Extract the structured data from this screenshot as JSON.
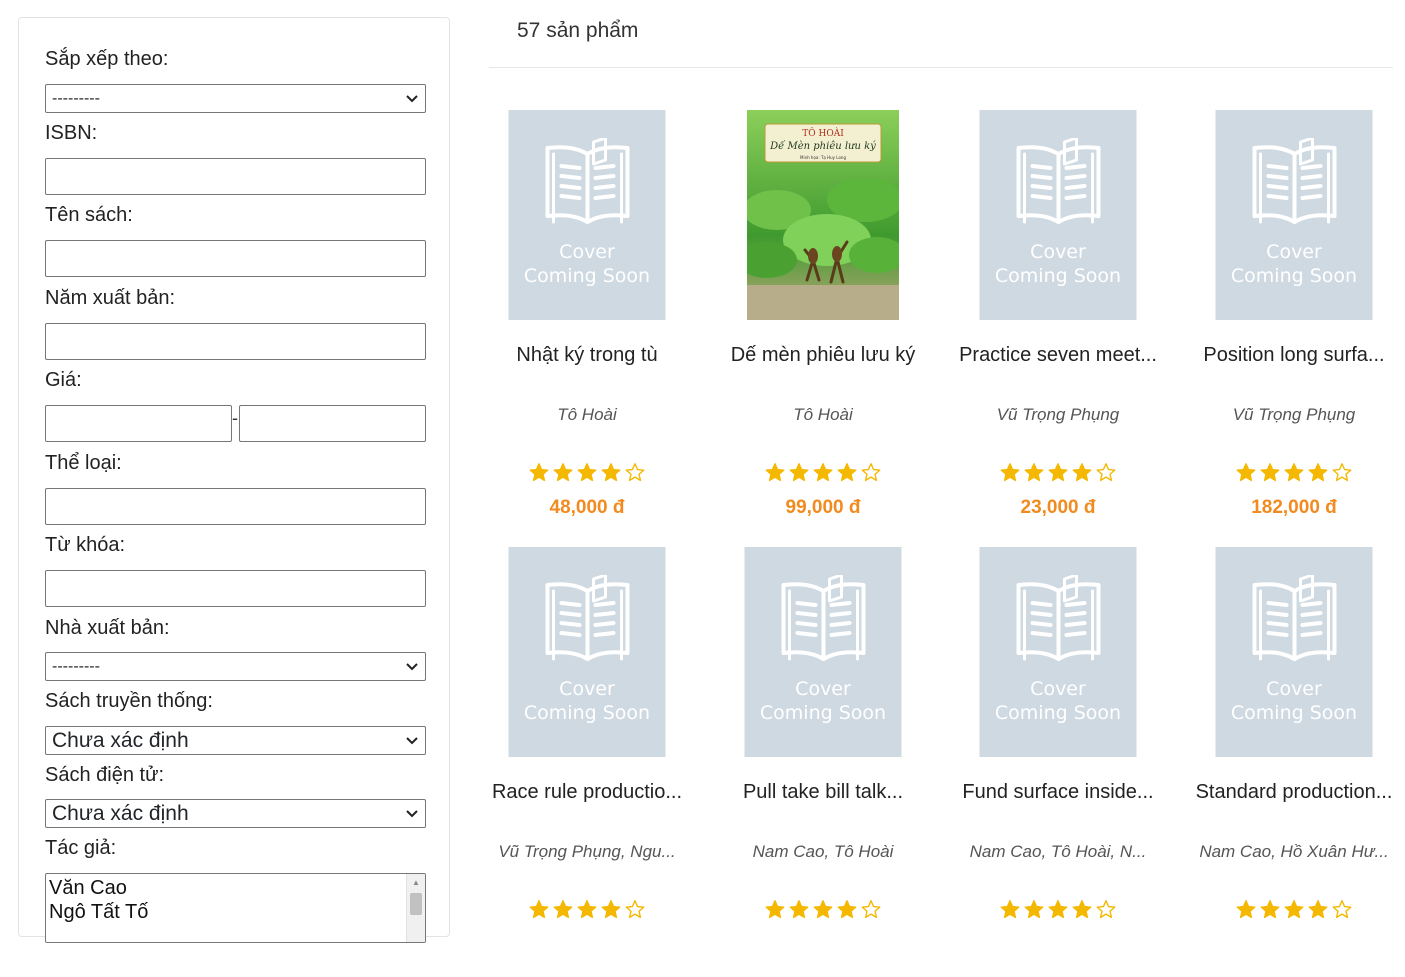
{
  "filters": {
    "sort_label": "Sắp xếp theo:",
    "sort_value": "---------",
    "isbn_label": "ISBN:",
    "title_label": "Tên sách:",
    "year_label": "Năm xuất bản:",
    "price_label": "Giá:",
    "price_separator": "-",
    "genre_label": "Thể loại:",
    "keyword_label": "Từ khóa:",
    "publisher_label": "Nhà xuất bản:",
    "publisher_value": "---------",
    "traditional_label": "Sách truyền thống:",
    "traditional_value": "Chưa xác định",
    "ebook_label": "Sách điện tử:",
    "ebook_value": "Chưa xác định",
    "author_label": "Tác giả:",
    "author_options": [
      "Văn Cao",
      "Ngô Tất Tố"
    ]
  },
  "results": {
    "count_text": "57 sản phẩm"
  },
  "cover_placeholder": {
    "line1": "Cover",
    "line2": "Coming Soon",
    "background": "#cfd9e2"
  },
  "featured_cover": {
    "author": "TÔ HOÀI",
    "title": "Dế Mèn phiêu lưu ký",
    "illustrator": "Minh họa: Tạ Huy Long"
  },
  "colors": {
    "price": "#f28b1f",
    "star": "#f5b800"
  },
  "products": [
    {
      "title": "Nhật ký trong tù",
      "author": "Tô Hoài",
      "rating": 4,
      "price": "48,000 đ",
      "has_cover": false
    },
    {
      "title": "Dế mèn phiêu lưu ký",
      "author": "Tô Hoài",
      "rating": 4,
      "price": "99,000 đ",
      "has_cover": true
    },
    {
      "title": "Practice seven meet...",
      "author": "Vũ Trọng Phụng",
      "rating": 4,
      "price": "23,000 đ",
      "has_cover": false
    },
    {
      "title": "Position long surfa...",
      "author": "Vũ Trọng Phụng",
      "rating": 4,
      "price": "182,000 đ",
      "has_cover": false
    },
    {
      "title": "Race rule productio...",
      "author": "Vũ Trọng Phụng, Ngu...",
      "rating": 4,
      "price": "",
      "has_cover": false
    },
    {
      "title": "Pull take bill talk...",
      "author": "Nam Cao, Tô Hoài",
      "rating": 4,
      "price": "",
      "has_cover": false
    },
    {
      "title": "Fund surface inside...",
      "author": "Nam Cao, Tô Hoài, N...",
      "rating": 4,
      "price": "",
      "has_cover": false
    },
    {
      "title": "Standard production...",
      "author": "Nam Cao, Hồ Xuân Hư...",
      "rating": 4,
      "price": "",
      "has_cover": false
    }
  ]
}
